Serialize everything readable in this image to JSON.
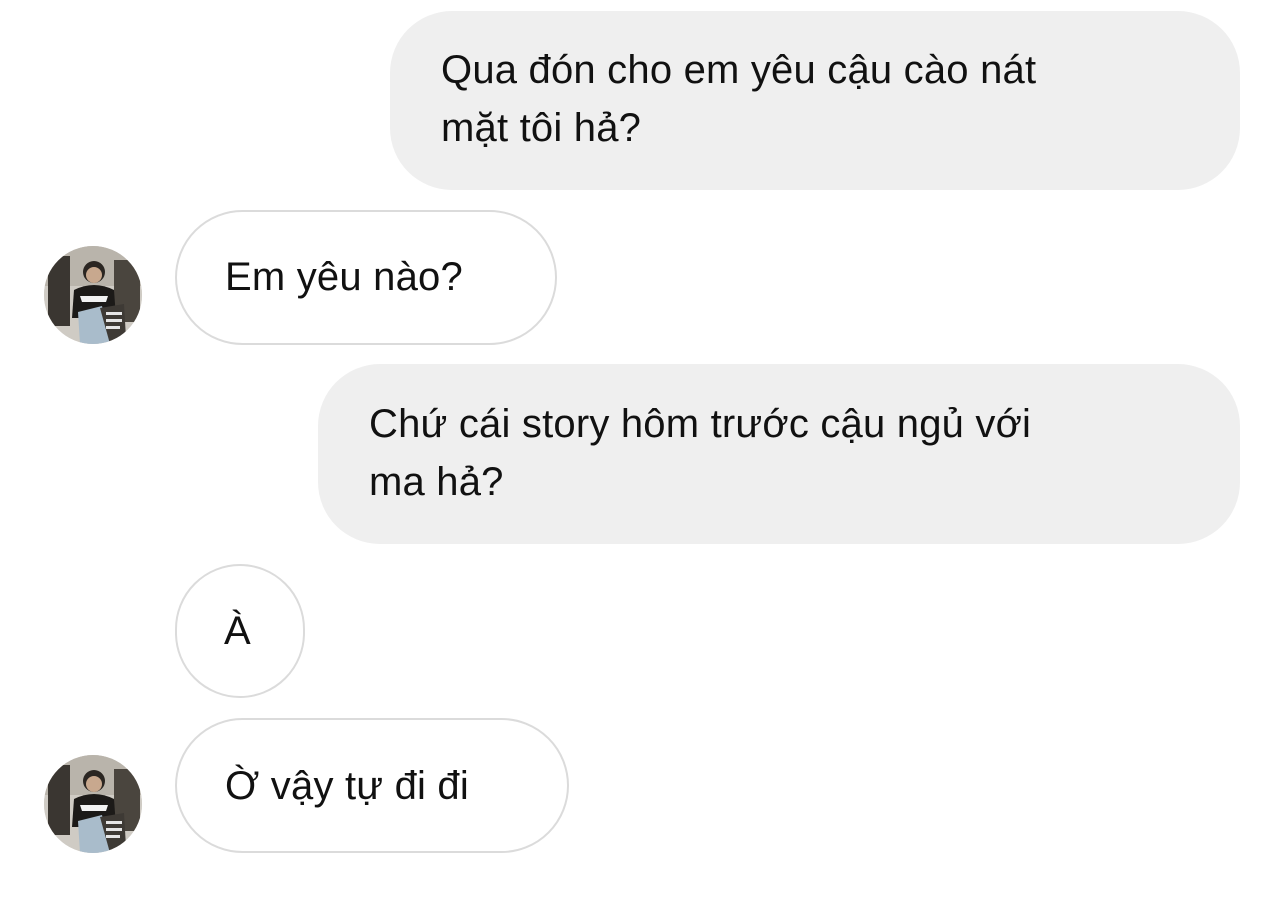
{
  "thread": {
    "messages": [
      {
        "direction": "sent",
        "text": "Qua đón cho em yêu cậu cào nát\nmặt tôi hả?"
      },
      {
        "direction": "received",
        "text": "Em yêu nào?",
        "show_avatar": true
      },
      {
        "direction": "sent",
        "text": "Chứ cái story hôm trước cậu ngủ với\nma hả?"
      },
      {
        "direction": "received",
        "text": "À",
        "show_avatar": false
      },
      {
        "direction": "received",
        "text": "Ờ vậy tự đi đi",
        "show_avatar": true
      }
    ]
  },
  "colors": {
    "sent_bubble": "#efefef",
    "received_border": "#dbdbdb",
    "text": "#111111",
    "background": "#ffffff"
  },
  "icons": {
    "avatar": "profile-photo"
  }
}
